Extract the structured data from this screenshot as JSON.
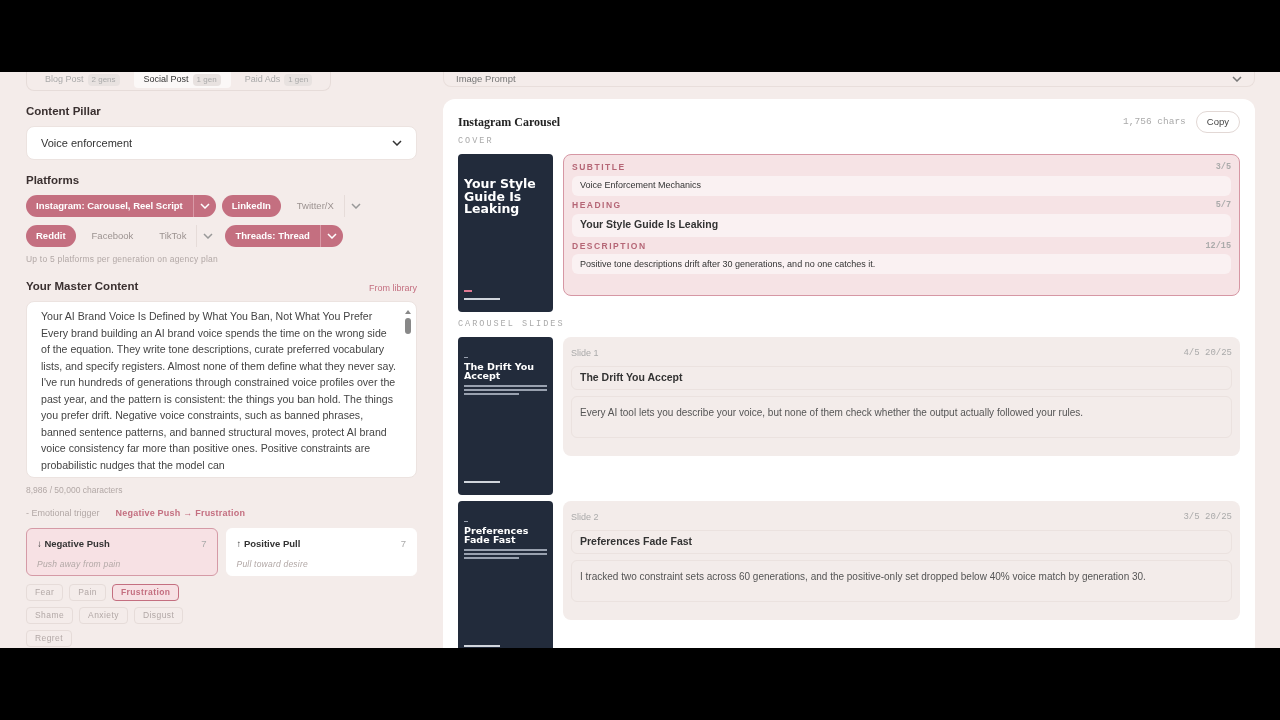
{
  "content_tabs": [
    {
      "label": "Blog Post",
      "count": "2 gens",
      "selected": false
    },
    {
      "label": "Social Post",
      "count": "1 gen",
      "selected": true
    },
    {
      "label": "Paid Ads",
      "count": "1 gen",
      "selected": false
    }
  ],
  "content_pillar": {
    "label": "Content Pillar",
    "value": "Voice enforcement"
  },
  "platforms": {
    "label": "Platforms",
    "items": [
      {
        "label": "Instagram: Carousel, Reel Script",
        "selected": true,
        "dropdown": true
      },
      {
        "label": "LinkedIn",
        "selected": true,
        "dropdown": false
      },
      {
        "label": "Twitter/X",
        "selected": false,
        "dropdown": true
      },
      {
        "label": "Reddit",
        "selected": true,
        "dropdown": false
      },
      {
        "label": "Facebook",
        "selected": false,
        "dropdown": false
      },
      {
        "label": "TikTok",
        "selected": false,
        "dropdown": true
      },
      {
        "label": "Threads: Thread",
        "selected": true,
        "dropdown": true
      }
    ],
    "note": "Up to 5 platforms per generation on agency plan"
  },
  "master_content": {
    "label": "Your Master Content",
    "link": "From library",
    "text": "Your AI Brand Voice Is Defined by What You Ban, Not What You Prefer\nEvery brand building an AI brand voice spends the time on the wrong side of the equation. They write tone descriptions, curate preferred vocabulary lists, and specify registers. Almost none of them define what they never say. I've run hundreds of generations through constrained voice profiles over the past year, and the pattern is consistent: the things you ban hold. The things you prefer drift. Negative voice constraints, such as banned phrases, banned sentence patterns, and banned structural moves, protect AI brand voice consistency far more than positive ones. Positive constraints are probabilistic nudges that the model can",
    "count": "8,986 / 50,000 characters"
  },
  "emotional_trigger": {
    "toggle": "-",
    "label": "Emotional trigger",
    "badge": "Negative Push → Frustration",
    "directions": [
      {
        "arrow": "↓",
        "title": "Negative Push",
        "count": "7",
        "hint": "Push away from pain",
        "selected": true
      },
      {
        "arrow": "↑",
        "title": "Positive Pull",
        "count": "7",
        "hint": "Pull toward desire",
        "selected": false
      }
    ],
    "emotions": [
      {
        "label": "Fear",
        "selected": false
      },
      {
        "label": "Pain",
        "selected": false
      },
      {
        "label": "Frustration",
        "selected": true
      },
      {
        "label": "Shame",
        "selected": false
      },
      {
        "label": "Anxiety",
        "selected": false
      },
      {
        "label": "Disgust",
        "selected": false
      },
      {
        "label": "Regret",
        "selected": false
      }
    ]
  },
  "image_prompt": {
    "label": "Image Prompt",
    "expanded": false
  },
  "output": {
    "title": "Instagram Carousel",
    "chars": "1,756 chars",
    "copy": "Copy",
    "cover_label": "COVER",
    "cover": {
      "thumb_title": "Your Style Guide Is Leaking",
      "selected": true,
      "fields": [
        {
          "label": "SUBTITLE",
          "count": "3/5",
          "value": "Voice Enforcement Mechanics",
          "kind": "plain"
        },
        {
          "label": "HEADING",
          "count": "5/7",
          "value": "Your Style Guide Is Leaking",
          "kind": "bold"
        },
        {
          "label": "DESCRIPTION",
          "count": "12/15",
          "value": "Positive tone descriptions drift after 30 generations, and no one catches it.",
          "kind": "plain"
        }
      ]
    },
    "slides_label": "CAROUSEL SLIDES",
    "slides": [
      {
        "label": "Slide 1",
        "counts": "4/5 20/25",
        "thumb_title": "The Drift You Accept",
        "title": "The Drift You Accept",
        "body": "Every AI tool lets you describe your voice, but none of them check whether the output actually followed your rules."
      },
      {
        "label": "Slide 2",
        "counts": "3/5 20/25",
        "thumb_title": "Preferences Fade Fast",
        "title": "Preferences Fade Fast",
        "body": "I tracked two constraint sets across 60 generations, and the positive-only set dropped below 40% voice match by generation 30."
      }
    ]
  }
}
